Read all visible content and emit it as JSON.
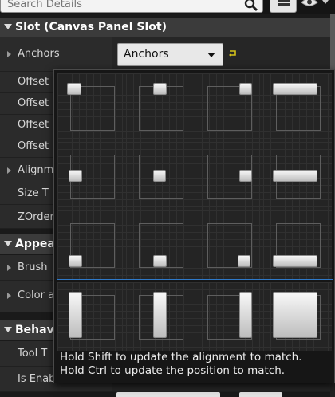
{
  "search": {
    "placeholder": "Search Details"
  },
  "sections": {
    "slot": {
      "title": "Slot (Canvas Panel Slot)"
    },
    "appearance": {
      "title": "Appea"
    },
    "behavior": {
      "title": "Behav"
    }
  },
  "slot_rows": {
    "anchors": "Anchors",
    "offset_1": "Offset",
    "offset_2": "Offset",
    "offset_3": "Offset",
    "offset_4": "Offset",
    "alignment": "Alignm",
    "size_to_content": "Size T",
    "zorder": "ZOrder"
  },
  "appearance_rows": {
    "brush": "Brush",
    "color": "Color a"
  },
  "behavior_rows": {
    "tooltip": "Tool T",
    "is_enabled": "Is Enab"
  },
  "anchors_combo": {
    "value": "Anchors"
  },
  "popup": {
    "hint_shift": "Hold Shift to update the alignment to match.",
    "hint_ctrl": "Hold Ctrl to update the position to match.",
    "presets": [
      "top-left",
      "top-center",
      "top-right",
      "top-stretch",
      "center-left",
      "center",
      "center-right",
      "center-stretch",
      "bottom-left",
      "bottom-center",
      "bottom-right",
      "bottom-stretch",
      "stretch-left",
      "stretch-center",
      "stretch-right",
      "stretch-full"
    ]
  },
  "colors": {
    "accent_divider": "#2f79c8",
    "reset_arrow": "#d4c21a",
    "header_bg": "#3b3b3b",
    "popup_bg": "#161616"
  }
}
